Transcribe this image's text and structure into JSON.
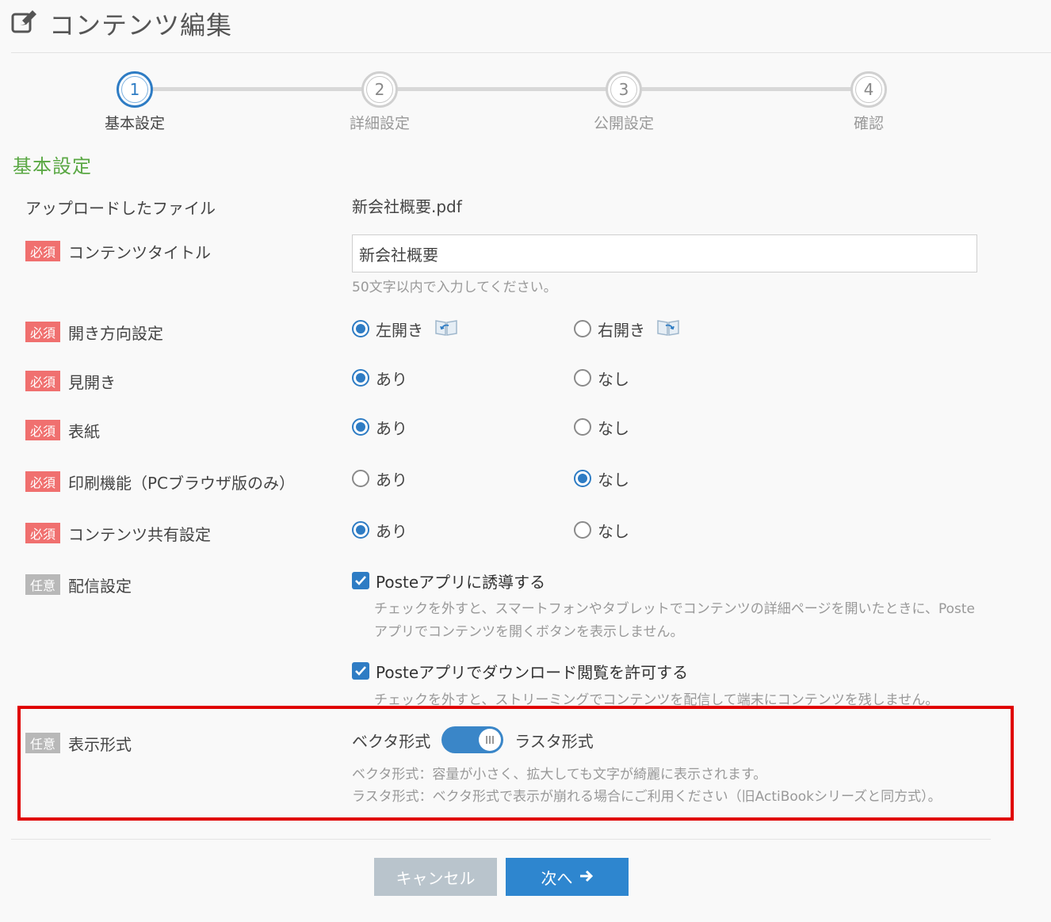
{
  "header": {
    "title": "コンテンツ編集",
    "icon": "edit-icon"
  },
  "stepper": {
    "steps": [
      {
        "num": "1",
        "label": "基本設定",
        "active": true
      },
      {
        "num": "2",
        "label": "詳細設定",
        "active": false
      },
      {
        "num": "3",
        "label": "公開設定",
        "active": false
      },
      {
        "num": "4",
        "label": "確認",
        "active": false
      }
    ]
  },
  "section": {
    "title": "基本設定"
  },
  "badges": {
    "required": "必須",
    "optional": "任意"
  },
  "form": {
    "uploaded_file": {
      "label": "アップロードしたファイル",
      "value": "新会社概要.pdf"
    },
    "content_title": {
      "label": "コンテンツタイトル",
      "value": "新会社概要",
      "help": "50文字以内で入力してください。"
    },
    "open_direction": {
      "label": "開き方向設定",
      "options": [
        "左開き",
        "右開き"
      ],
      "selected": "左開き"
    },
    "spread": {
      "label": "見開き",
      "options": [
        "あり",
        "なし"
      ],
      "selected": "あり"
    },
    "cover": {
      "label": "表紙",
      "options": [
        "あり",
        "なし"
      ],
      "selected": "あり"
    },
    "print": {
      "label": "印刷機能（PCブラウザ版のみ）",
      "options": [
        "あり",
        "なし"
      ],
      "selected": "なし"
    },
    "share": {
      "label": "コンテンツ共有設定",
      "options": [
        "あり",
        "なし"
      ],
      "selected": "あり"
    },
    "delivery": {
      "label": "配信設定",
      "check1": {
        "label": "Posteアプリに誘導する",
        "checked": true,
        "help": "チェックを外すと、スマートフォンやタブレットでコンテンツの詳細ページを開いたときに、Poste アプリでコンテンツを開くボタンを表示しません。"
      },
      "check2": {
        "label": "Posteアプリでダウンロード閲覧を許可する",
        "checked": true,
        "help": "チェックを外すと、ストリーミングでコンテンツを配信して端末にコンテンツを残しません。"
      }
    },
    "display_format": {
      "label": "表示形式",
      "left_option": "ベクタ形式",
      "right_option": "ラスタ形式",
      "selected": "ラスタ形式",
      "help1": "ベクタ形式：容量が小さく、拡大しても文字が綺麗に表示されます。",
      "help2": "ラスタ形式：ベクタ形式で表示が崩れる場合にご利用ください（旧ActiBookシリーズと同方式）。"
    }
  },
  "buttons": {
    "cancel": "キャンセル",
    "next": "次へ"
  },
  "colors": {
    "accent": "#2e7cc4",
    "section": "#5aa844",
    "required": "#f0706f",
    "highlight": "#e00000"
  }
}
